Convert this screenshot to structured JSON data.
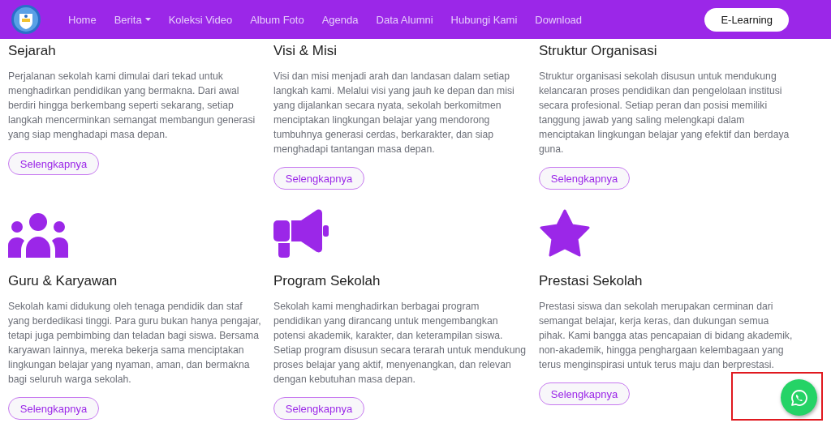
{
  "navbar": {
    "items": [
      {
        "label": "Home",
        "kind": "link"
      },
      {
        "label": "Berita",
        "kind": "dropdown"
      },
      {
        "label": "Koleksi Video",
        "kind": "link"
      },
      {
        "label": "Album Foto",
        "kind": "link"
      },
      {
        "label": "Agenda",
        "kind": "link"
      },
      {
        "label": "Data Alumni",
        "kind": "link"
      },
      {
        "label": "Hubungi Kami",
        "kind": "link"
      },
      {
        "label": "Download",
        "kind": "link"
      }
    ],
    "cta": "E-Learning"
  },
  "cards": [
    {
      "kind": "text",
      "title": "Sejarah",
      "text": "Perjalanan sekolah kami dimulai dari tekad untuk menghadirkan pendidikan yang bermakna. Dari awal berdiri hingga berkembang seperti sekarang, setiap langkah mencerminkan semangat membangun generasi yang siap menghadapi masa depan.",
      "button": "Selengkapnya"
    },
    {
      "kind": "text",
      "title": "Visi & Misi",
      "text": "Visi dan misi menjadi arah dan landasan dalam setiap langkah kami. Melalui visi yang jauh ke depan dan misi yang dijalankan secara nyata, sekolah berkomitmen menciptakan lingkungan belajar yang mendorong tumbuhnya generasi cerdas, berkarakter, dan siap menghadapi tantangan masa depan.",
      "button": "Selengkapnya"
    },
    {
      "kind": "text",
      "title": "Struktur Organisasi",
      "text": "Struktur organisasi sekolah disusun untuk mendukung kelancaran proses pendidikan dan pengelolaan institusi secara profesional. Setiap peran dan posisi memiliki tanggung jawab yang saling melengkapi dalam menciptakan lingkungan belajar yang efektif dan berdaya guna.",
      "button": "Selengkapnya"
    },
    {
      "kind": "icon",
      "title": "Guru & Karyawan",
      "text": "Sekolah kami didukung oleh tenaga pendidik dan staf yang berdedikasi tinggi. Para guru bukan hanya pengajar, tetapi juga pembimbing dan teladan bagi siswa. Bersama karyawan lainnya, mereka bekerja sama menciptakan lingkungan belajar yang nyaman, aman, dan bermakna bagi seluruh warga sekolah.",
      "button": "Selengkapnya"
    },
    {
      "kind": "icon",
      "title": "Program Sekolah",
      "text": "Sekolah kami menghadirkan berbagai program pendidikan yang dirancang untuk mengembangkan potensi akademik, karakter, dan keterampilan siswa. Setiap program disusun secara terarah untuk mendukung proses belajar yang aktif, menyenangkan, dan relevan dengan kebutuhan masa depan.",
      "button": "Selengkapnya"
    },
    {
      "kind": "icon",
      "title": "Prestasi Sekolah",
      "text": "Prestasi siswa dan sekolah merupakan cerminan dari semangat belajar, kerja keras, dan dukungan semua pihak. Kami bangga atas pencapaian di bidang akademik, non-akademik, hingga penghargaan kelembagaan yang terus menginspirasi untuk terus maju dan berprestasi.",
      "button": "Selengkapnya"
    }
  ]
}
